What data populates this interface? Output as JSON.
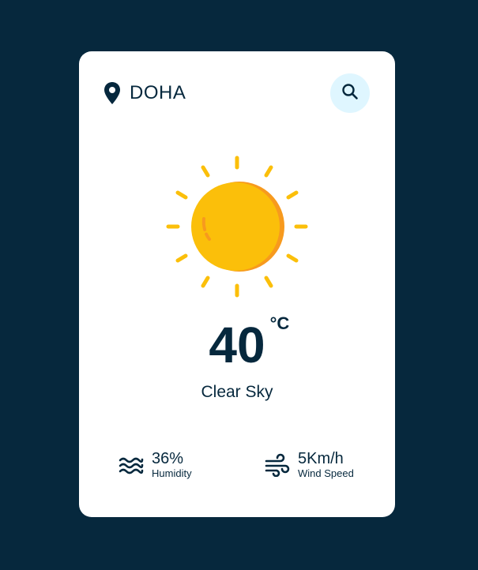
{
  "location": {
    "city": "DOHA",
    "icon": "location-pin-icon"
  },
  "search": {
    "icon": "search-icon"
  },
  "weather": {
    "icon": "sun-icon",
    "temperature": "40",
    "unit": "°C",
    "description": "Clear Sky"
  },
  "details": {
    "humidity": {
      "value": "36%",
      "label": "Humidity",
      "icon": "water-waves-icon"
    },
    "wind": {
      "value": "5Km/h",
      "label": "Wind Speed",
      "icon": "wind-icon"
    }
  },
  "colors": {
    "background": "#06283d",
    "card": "#ffffff",
    "text": "#06283d",
    "search_bg": "#dff6ff",
    "sun": "#fbbf0a",
    "sun_shadow": "#f79a1e"
  }
}
